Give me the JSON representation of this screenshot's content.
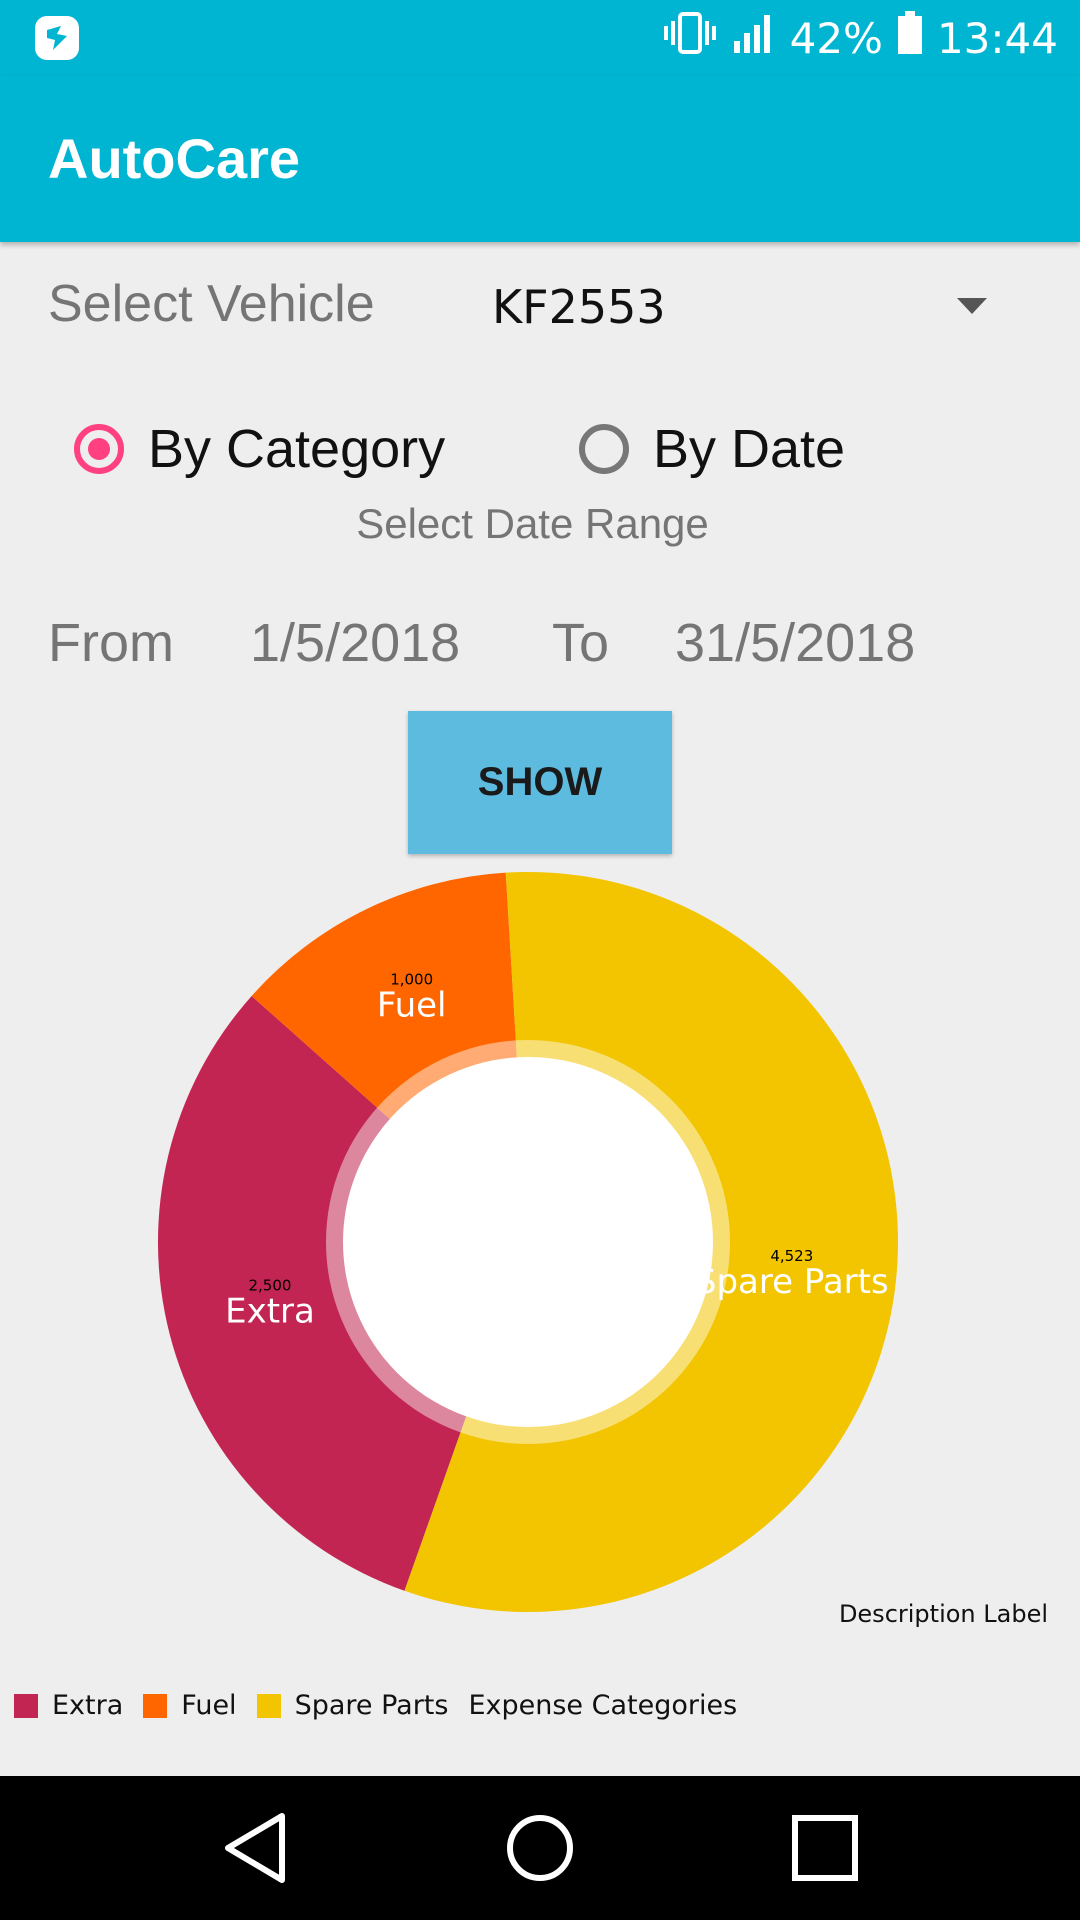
{
  "status_bar": {
    "battery_percent": "42%",
    "time": "13:44",
    "icons": [
      "app-notification-icon",
      "vibrate-icon",
      "signal-icon",
      "battery-icon"
    ]
  },
  "app_bar": {
    "title": "AutoCare"
  },
  "form": {
    "vehicle_label": "Select Vehicle",
    "vehicle_value": "KF2553",
    "radio_by_category": "By Category",
    "radio_by_date": "By Date",
    "selected_mode": "By Category",
    "date_range_title": "Select Date Range",
    "from_label": "From",
    "from_value": "1/5/2018",
    "to_label": "To",
    "to_value": "31/5/2018",
    "show_button": "SHOW"
  },
  "colors": {
    "primary": "#00b5d1",
    "accent": "#ff4081",
    "button": "#5dbbe0"
  },
  "chart_data": {
    "type": "pie",
    "style": "donut",
    "categories": [
      "Extra",
      "Fuel",
      "Spare Parts"
    ],
    "values": [
      2500,
      1000,
      4523
    ],
    "value_labels": [
      "2,500",
      "1,000",
      "4,523"
    ],
    "colors": [
      "#c22551",
      "#ff6600",
      "#f2c500"
    ],
    "description": "Description Label",
    "legend_title": "Expense Categories",
    "legend_position": "bottom-left"
  },
  "nav_bar": {
    "buttons": [
      "back",
      "home",
      "recents"
    ]
  }
}
